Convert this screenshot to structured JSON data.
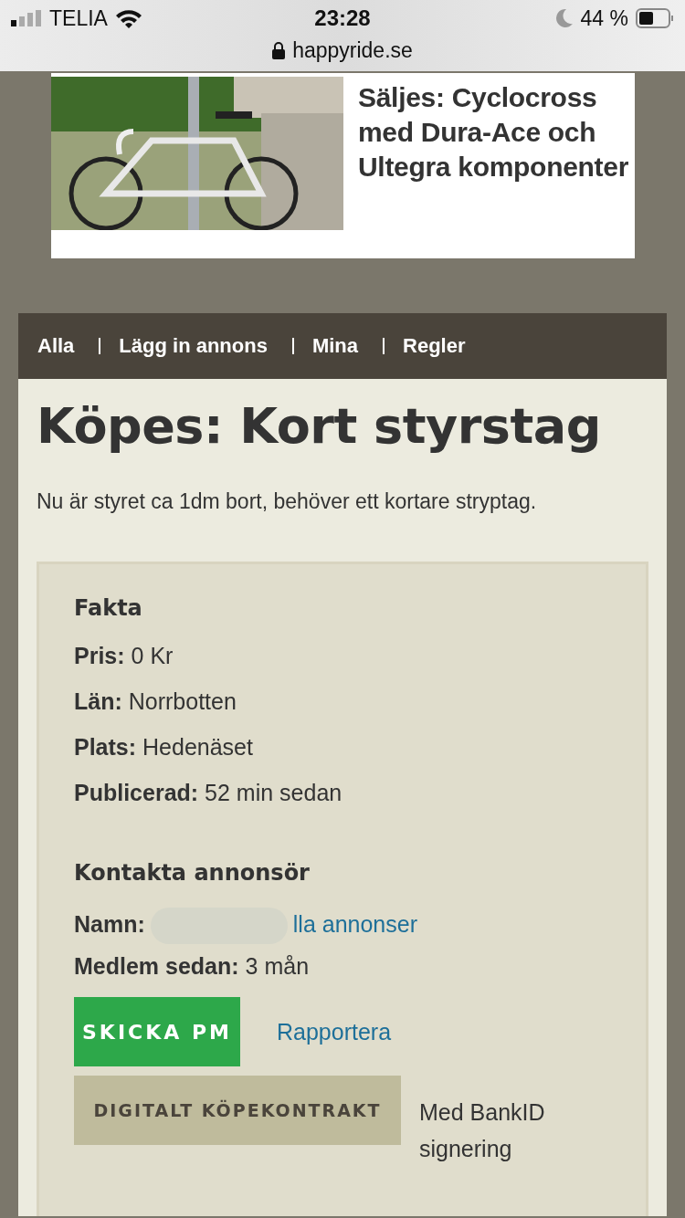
{
  "status_bar": {
    "carrier": "TELIA",
    "time": "23:28",
    "battery": "44 %",
    "url": "happyride.se"
  },
  "ad": {
    "title": "Säljes: Cyclocross med Dura-Ace och Ultegra komponenter"
  },
  "nav": {
    "items": [
      {
        "label": "Alla"
      },
      {
        "label": "Lägg in annons"
      },
      {
        "label": "Mina"
      },
      {
        "label": "Regler"
      }
    ]
  },
  "listing": {
    "title": "Köpes: Kort styrstag",
    "description": "Nu är styret ca 1dm bort, behöver ett kortare stryptag."
  },
  "facts": {
    "heading": "Fakta",
    "rows": [
      {
        "label": "Pris:",
        "value": "0 Kr"
      },
      {
        "label": "Län:",
        "value": "Norrbotten"
      },
      {
        "label": "Plats:",
        "value": "Hedenäset"
      },
      {
        "label": "Publicerad:",
        "value": "52 min sedan"
      }
    ]
  },
  "contact": {
    "heading": "Kontakta annonsör",
    "name_label": "Namn:",
    "name_link": "lla annonser",
    "member_label": "Medlem sedan:",
    "member_value": "3 mån",
    "send_button": "SKICKA PM",
    "report_link": "Rapportera",
    "contract_button": "DIGITALT KÖPEKONTRAKT",
    "contract_note": "Med BankID signering"
  }
}
